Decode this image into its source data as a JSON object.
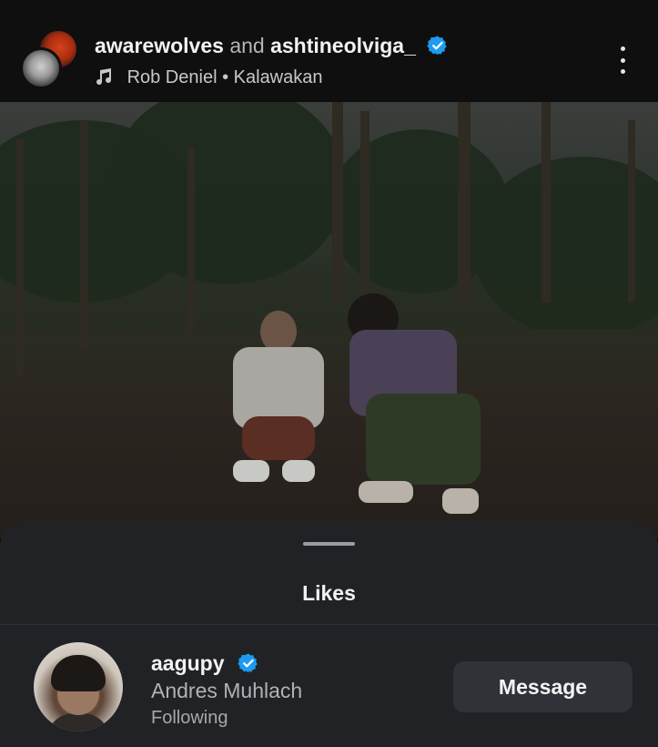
{
  "post_header": {
    "author_primary": "awarewolves",
    "connector": "and",
    "author_secondary": "ashtineolviga_",
    "music_artist": "Rob Deniel",
    "music_separator": "•",
    "music_title": "Kalawakan",
    "verified_icon": "verified-badge-icon",
    "more_icon": "more-vertical-icon"
  },
  "likes_sheet": {
    "title": "Likes",
    "users": [
      {
        "username": "aagupy",
        "full_name": "Andres Muhlach",
        "status": "Following",
        "verified": true,
        "action_label": "Message"
      }
    ]
  },
  "colors": {
    "verified": "#1d9bf0",
    "sheet_bg": "#202226",
    "button_bg": "#2f3237",
    "header_bg": "#0f0f10"
  }
}
